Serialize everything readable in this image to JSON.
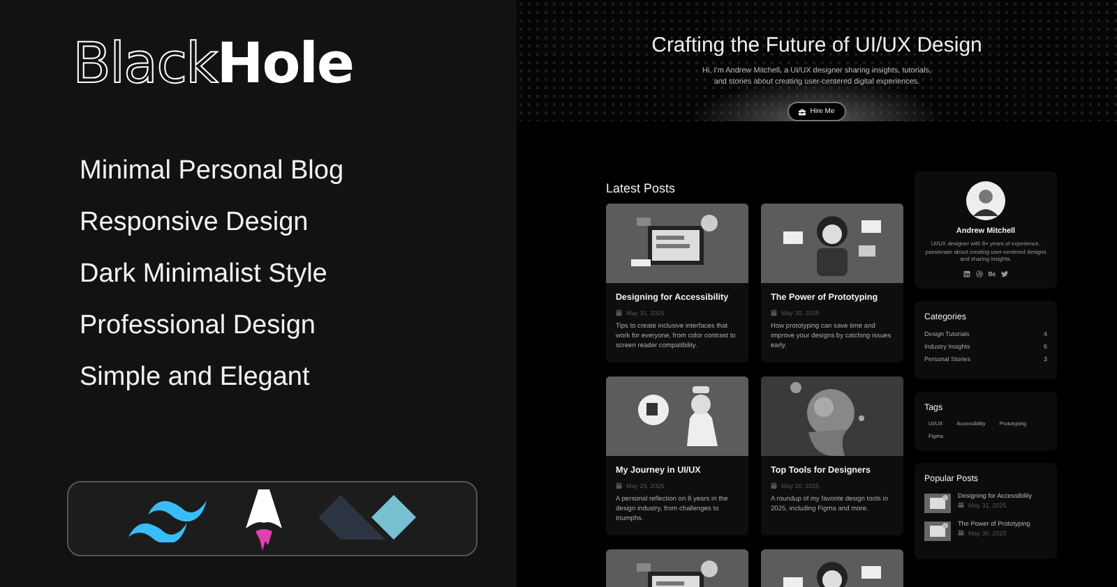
{
  "brand": {
    "outline": "Black",
    "solid": "Hole"
  },
  "features": [
    "Minimal Personal Blog",
    "Responsive Design",
    "Dark Minimalist Style",
    "Professional Design",
    "Simple and Elegant"
  ],
  "tech_logos": [
    {
      "kind": "tailwind"
    },
    {
      "kind": "astro"
    },
    {
      "kind": "alpine"
    }
  ],
  "hero": {
    "title": "Crafting the Future of UI/UX Design",
    "subtitle": "Hi, I'm Andrew Mitchell, a UI/UX designer sharing insights, tutorials, and stories about creating user-centered digital experiences.",
    "button": "Hire Me"
  },
  "latest_posts": {
    "heading": "Latest Posts",
    "posts": [
      {
        "kind": "post",
        "title": "Designing for Accessibility",
        "date": "May 31, 2025",
        "excerpt": "Tips to create inclusive interfaces that work for everyone, from color contrast to screen reader compatibility."
      },
      {
        "kind": "post",
        "title": "The Power of Prototyping",
        "date": "May 30, 2025",
        "excerpt": "How prototyping can save time and improve your designs by catching issues early."
      },
      {
        "kind": "post",
        "title": "My Journey in UI/UX",
        "date": "May 29, 2025",
        "excerpt": "A personal reflection on 8 years in the design industry, from challenges to triumphs."
      },
      {
        "kind": "post",
        "title": "Top Tools for Designers",
        "date": "May 28, 2025",
        "excerpt": "A roundup of my favorite design tools in 2025, including Figma and more."
      },
      {
        "kind": "picture"
      },
      {
        "kind": "picture"
      }
    ]
  },
  "profile": {
    "name": "Andrew Mitchell",
    "bio": "UI/UX designer with 8+ years of experience, passionate about creating user-centered designs and sharing insights.",
    "socials": [
      {
        "kind": "linkedin"
      },
      {
        "kind": "dribbble"
      },
      {
        "kind": "behance"
      },
      {
        "kind": "twitter"
      }
    ]
  },
  "categories": {
    "heading": "Categories",
    "items": [
      {
        "name": "Design Tutorials",
        "count": "4"
      },
      {
        "name": "Industry Insights",
        "count": "6"
      },
      {
        "name": "Personal Stories",
        "count": "3"
      }
    ]
  },
  "tags": {
    "heading": "Tags",
    "items": [
      "UI/UX",
      "Accessibility",
      "Prototyping",
      "Figma"
    ]
  },
  "popular_posts": {
    "heading": "Popular Posts",
    "items": [
      {
        "title": "Designing for Accessibility",
        "date": "May 31, 2025"
      },
      {
        "title": "The Power of Prototyping",
        "date": "May 30, 2025"
      }
    ]
  }
}
